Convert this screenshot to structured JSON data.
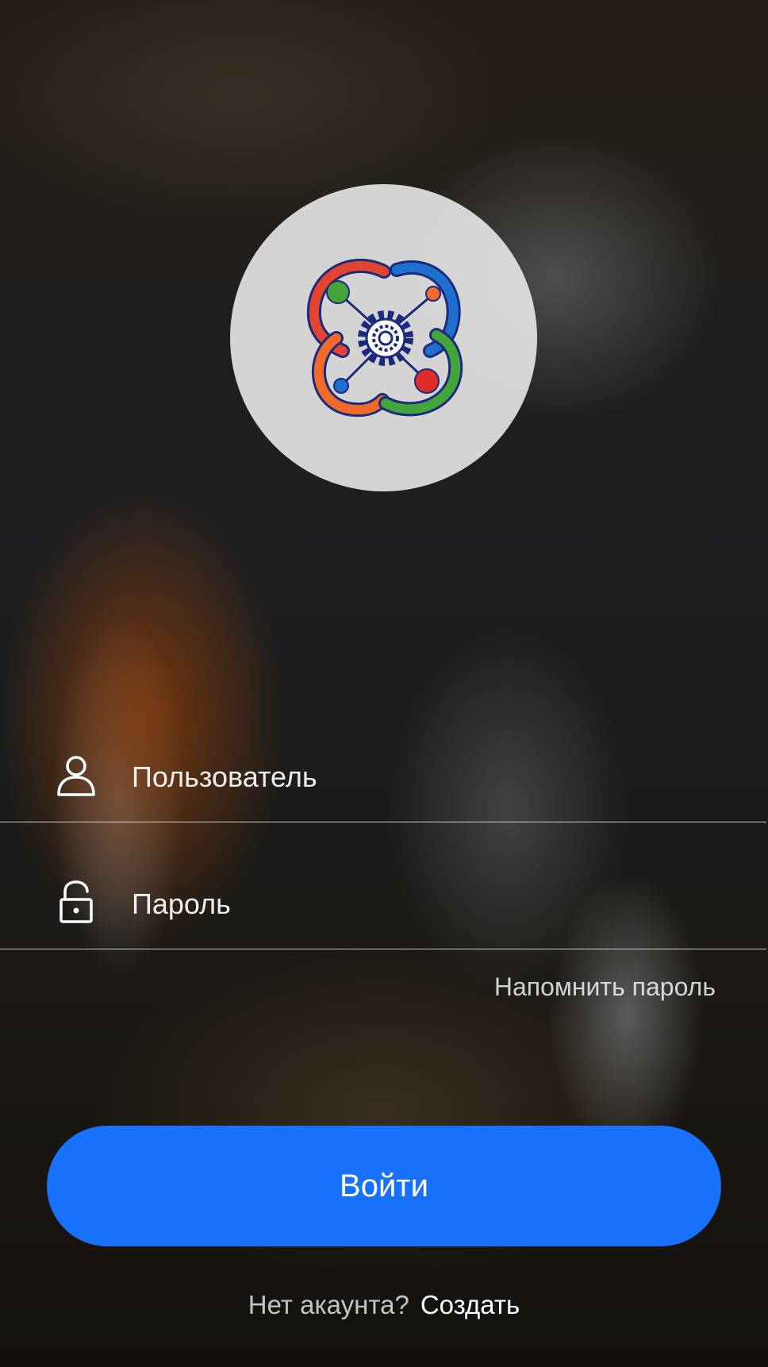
{
  "logo": {
    "icon": "atom-gear-logo-icon"
  },
  "form": {
    "username_placeholder": "Пользователь",
    "username_icon": "user-icon",
    "password_placeholder": "Пароль",
    "password_icon": "unlock-icon"
  },
  "forgot_password_label": "Напомнить пароль",
  "login_button_label": "Войти",
  "signup": {
    "question": "Нет акаунта?",
    "link_label": "Создать"
  },
  "colors": {
    "accent": "#1871fa",
    "logo_red": "#e2452f",
    "logo_blue": "#1f6fd0",
    "logo_green": "#43a53a",
    "logo_navy": "#1b2a7a"
  }
}
